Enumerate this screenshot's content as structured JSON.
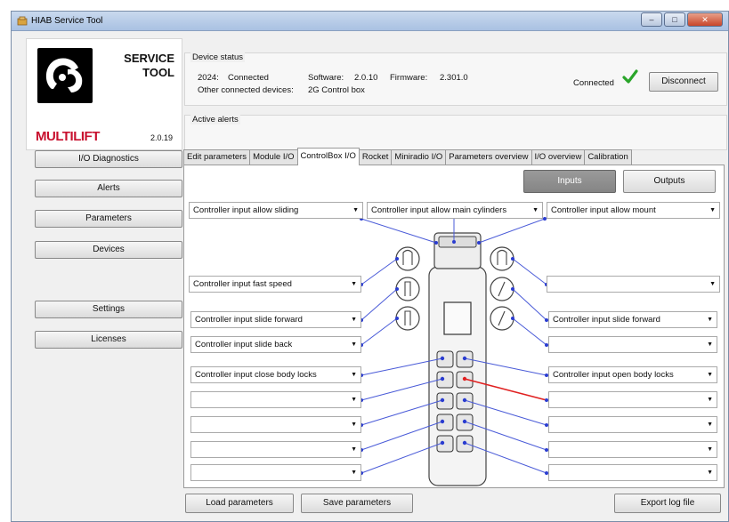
{
  "window": {
    "title": "HIAB Service Tool",
    "controls": [
      "–",
      "□",
      "✕"
    ]
  },
  "brand": {
    "line1": "SERVICE",
    "line2": "TOOL",
    "name": "MULTILIFT",
    "version": "2.0.19"
  },
  "device_status": {
    "legend": "Device status",
    "id": "2024:",
    "status": "Connected",
    "software_label": "Software:",
    "software_value": "2.0.10",
    "firmware_label": "Firmware:",
    "firmware_value": "2.301.0",
    "other_label": "Other connected devices:",
    "other_value": "2G Control box",
    "connected_label": "Connected",
    "disconnect_label": "Disconnect"
  },
  "active_alerts": {
    "legend": "Active alerts"
  },
  "nav": [
    "I/O Diagnostics",
    "Alerts",
    "Parameters",
    "Devices",
    "Settings",
    "Licenses"
  ],
  "tabs": [
    "Edit parameters",
    "Module I/O",
    "ControlBox I/O",
    "Rocket",
    "Miniradio I/O",
    "Parameters overview",
    "I/O overview",
    "Calibration"
  ],
  "active_tab": "ControlBox I/O",
  "io_toggle": {
    "inputs": "Inputs",
    "outputs": "Outputs",
    "selected": "Inputs"
  },
  "top_combos": [
    "Controller input allow sliding",
    "Controller input allow main cylinders",
    "Controller input allow mount"
  ],
  "left_combos": [
    "Controller input fast speed",
    "Controller input slide forward",
    "Controller input slide back",
    "Controller input close body locks",
    "",
    "",
    "",
    ""
  ],
  "right_combos": [
    "",
    "Controller input slide forward",
    "",
    "Controller input open body locks",
    "",
    "",
    "",
    ""
  ],
  "footer": {
    "load": "Load parameters",
    "save": "Save parameters",
    "export": "Export log file"
  },
  "colors": {
    "link_line": "#4a5bd8",
    "active_link": "#e02020",
    "accent_check": "#2aa52a",
    "brand_red": "#c8102e"
  }
}
